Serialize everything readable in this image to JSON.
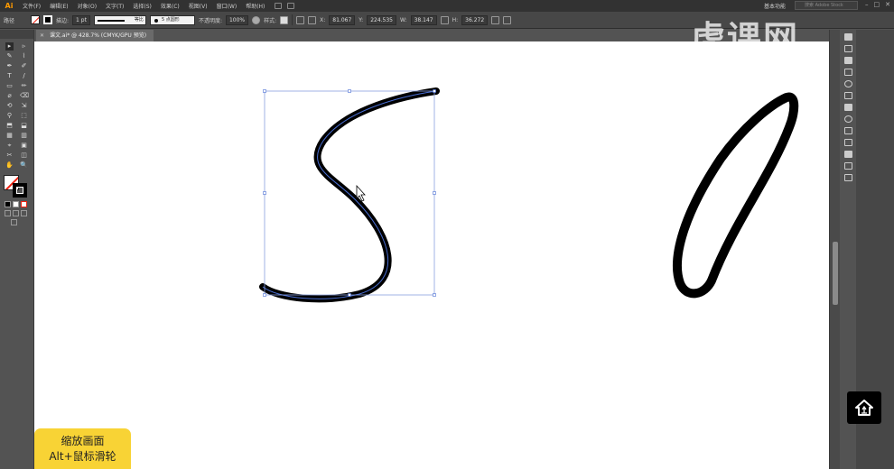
{
  "app": {
    "logo": "Ai"
  },
  "menubar": {
    "items": [
      "文件(F)",
      "编辑(E)",
      "对象(O)",
      "文字(T)",
      "选择(S)",
      "效果(C)",
      "视图(V)",
      "窗口(W)",
      "帮助(H)"
    ],
    "workspace": "基本功能",
    "search_placeholder": "搜索 Adobe Stock"
  },
  "controlbar": {
    "selection_label": "路径",
    "stroke_label": "描边:",
    "stroke_weight": "1 pt",
    "profile_label": "等比",
    "brush_label": "5 点圆形",
    "opacity_label": "不透明度:",
    "opacity_value": "100%",
    "style_label": "样式:",
    "x_value": "81.067",
    "y_value": "224.535",
    "w_value": "38.147",
    "h_value": "36.272"
  },
  "document": {
    "tab_title": "课文.ai* @ 428.7% (CMYK/GPU 预览)"
  },
  "tools": [
    "▸",
    "▹",
    "✎",
    "⌇",
    "✒",
    "✐",
    "T",
    "/",
    "▭",
    "✏",
    "⌀",
    "⌫",
    "⟲",
    "⇲",
    "⚲",
    "⬚",
    "⬒",
    "⬓",
    "▦",
    "▥",
    "⌖",
    "▣",
    "✂",
    "◫",
    "✋",
    "🔍"
  ],
  "watermark": {
    "text": "虎课网"
  },
  "tip": {
    "line1": "缩放画面",
    "line2": "Alt+鼠标滑轮"
  },
  "colors": {
    "accent_tip": "#f8d335",
    "selection_blue": "#4a6fd4",
    "stroke_black": "#000000"
  }
}
